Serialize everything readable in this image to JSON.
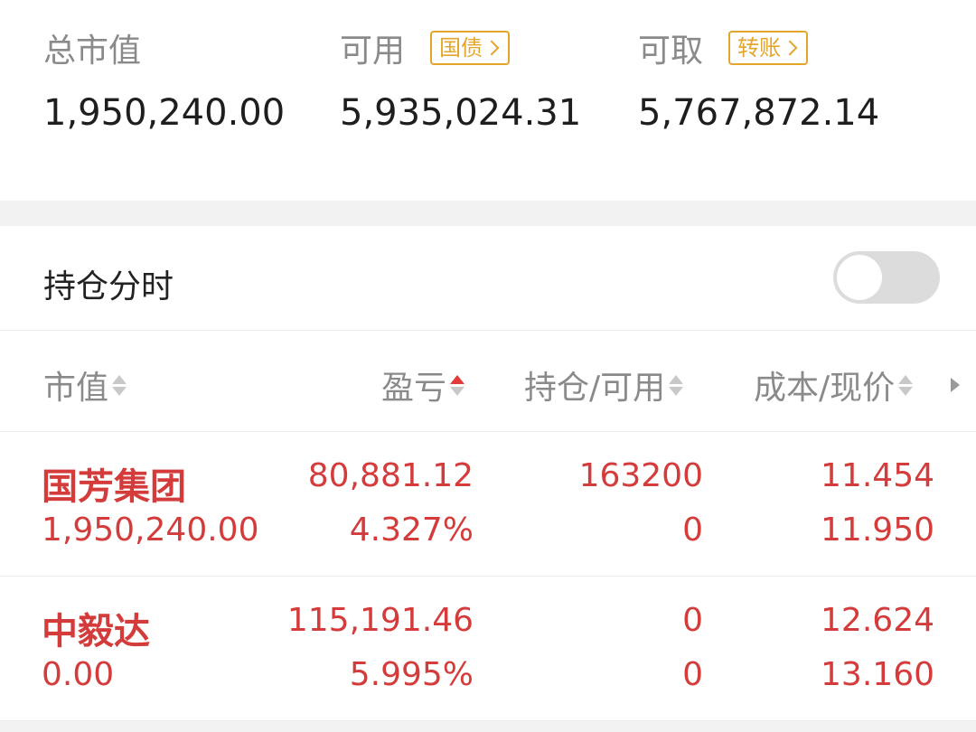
{
  "summary": {
    "market_value_label": "总市值",
    "market_value": "1,950,240.00",
    "available_label": "可用",
    "available_tag": "国债",
    "available": "5,935,024.31",
    "withdrawable_label": "可取",
    "withdrawable_tag": "转账",
    "withdrawable": "5,767,872.14"
  },
  "toggle": {
    "label": "持仓分时",
    "state": "off"
  },
  "table": {
    "headers": {
      "market_value": "市值",
      "pnl": "盈亏",
      "position": "持仓/可用",
      "cost_price": "成本/现价"
    },
    "active_sort": "pnl",
    "rows": [
      {
        "name": "国芳集团",
        "market_value": "1,950,240.00",
        "pnl": "80,881.12",
        "pnl_pct": "4.327%",
        "position": "163200",
        "available": "0",
        "cost": "11.454",
        "price": "11.950"
      },
      {
        "name": "中毅达",
        "market_value": "0.00",
        "pnl": "115,191.46",
        "pnl_pct": "5.995%",
        "position": "0",
        "available": "0",
        "cost": "12.624",
        "price": "13.160"
      }
    ]
  },
  "colors": {
    "profit_red": "#d43c3c",
    "tag_gold": "#e3a52b",
    "label_gray": "#8a8a8a"
  }
}
